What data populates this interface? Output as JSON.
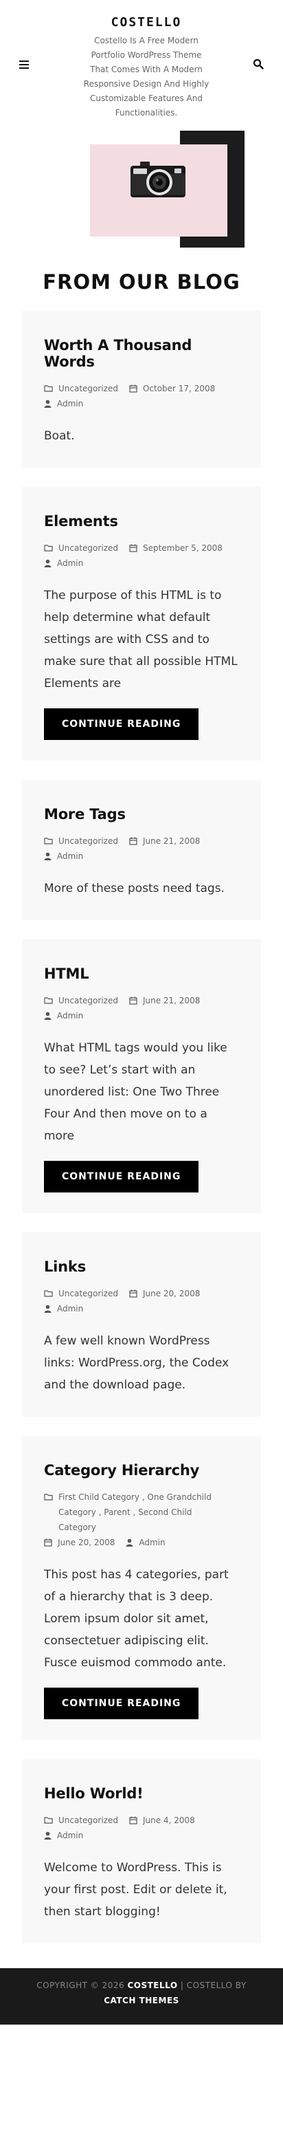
{
  "site": {
    "title": "COSTELLO",
    "description": "Costello Is A Free Modern Portfolio WordPress Theme That Comes With A Modern Responsive Design And Highly Customizable Features And Functionalities."
  },
  "section_title": "FROM OUR BLOG",
  "colors": {
    "accent": "#000000",
    "card_bg": "#f8f8f8",
    "hero_pink": "#f3dde0",
    "footer_bg": "#1a1a1a"
  },
  "read_more_label": "CONTINUE READING",
  "posts": [
    {
      "title": "Worth A Thousand Words",
      "categories": "Uncategorized",
      "date": "October 17, 2008",
      "author": "Admin",
      "excerpt": "Boat."
    },
    {
      "title": "Elements",
      "categories": "Uncategorized",
      "date": "September 5, 2008",
      "author": "Admin",
      "excerpt": "The purpose of this HTML is to help determine what default settings are with CSS and to make sure that all possible HTML Elements are"
    },
    {
      "title": "More Tags",
      "categories": "Uncategorized",
      "date": "June 21, 2008",
      "author": "Admin",
      "excerpt": "More of these posts need tags."
    },
    {
      "title": "HTML",
      "categories": "Uncategorized",
      "date": "June 21, 2008",
      "author": "Admin",
      "excerpt": "What HTML tags would you like to see? Let’s start with an unordered list: One Two Three Four And then move on to a more"
    },
    {
      "title": "Links",
      "categories": "Uncategorized",
      "date": "June 20, 2008",
      "author": "Admin",
      "excerpt": "A few well known WordPress links: WordPress.org, the Codex and the download page."
    },
    {
      "title": "Category Hierarchy",
      "categories": "First Child Category , One Grandchild Category , Parent , Second Child Category",
      "date": "June 20, 2008",
      "author": "Admin",
      "excerpt": "This post has 4 categories, part of a hierarchy that is 3 deep. Lorem ipsum dolor sit amet, consectetuer adipiscing elit. Fusce euismod commodo ante."
    },
    {
      "title": "Hello World!",
      "categories": "Uncategorized",
      "date": "June 4, 2008",
      "author": "Admin",
      "excerpt": "Welcome to WordPress. This is your first post. Edit or delete it, then start blogging!"
    }
  ],
  "footer": {
    "prefix": "COPYRIGHT © 2026",
    "site_name": "COSTELLO",
    "separator": "| COSTELLO BY",
    "author": "CATCH THEMES"
  }
}
